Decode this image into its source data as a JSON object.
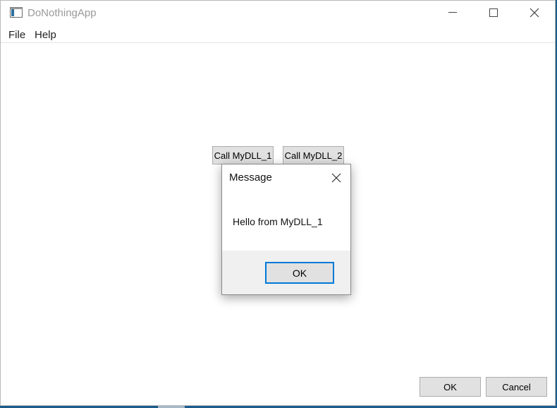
{
  "window": {
    "title": "DoNothingApp",
    "icon": "app-window-icon"
  },
  "titlebar_controls": [
    "minimize-icon",
    "maximize-icon",
    "close-icon"
  ],
  "menubar": {
    "file": "File",
    "help": "Help"
  },
  "main": {
    "call1_label": "Call MyDLL_1",
    "call2_label": "Call MyDLL_2",
    "ok_label": "OK",
    "cancel_label": "Cancel"
  },
  "dialog": {
    "title": "Message",
    "message": "Hello from MyDLL_1",
    "ok_label": "OK",
    "close_icon": "close-icon"
  },
  "colors": {
    "accent": "#0078d7",
    "desktop": "#1a5b8c",
    "button_face": "#e1e1e1"
  }
}
